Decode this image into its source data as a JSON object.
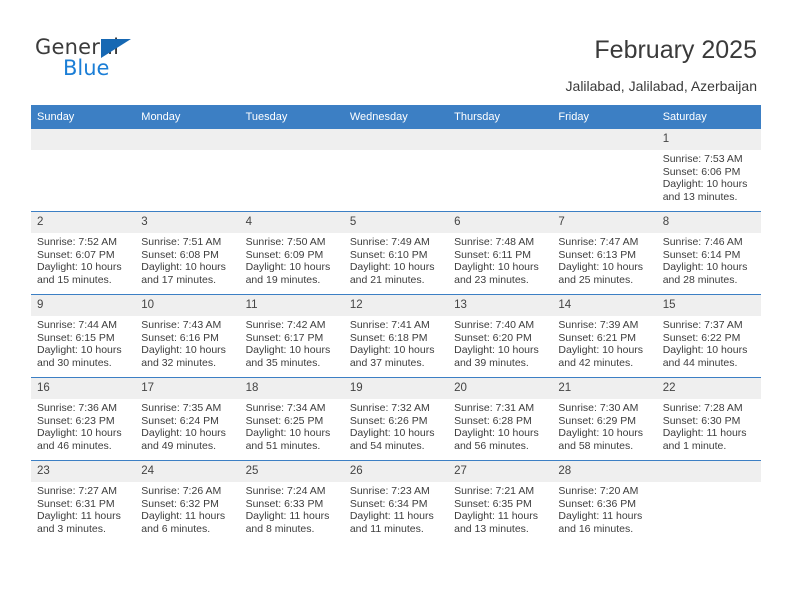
{
  "brand": {
    "name_top": "General",
    "name_bottom": "Blue",
    "accent_color": "#1b7ed6",
    "triangle_color": "#1668b3"
  },
  "header": {
    "title": "February 2025",
    "subtitle": "Jalilabad, Jalilabad, Azerbaijan"
  },
  "calendar": {
    "header_bg": "#3c7fc4",
    "daynum_bg": "#efefef",
    "weekdays": [
      "Sunday",
      "Monday",
      "Tuesday",
      "Wednesday",
      "Thursday",
      "Friday",
      "Saturday"
    ],
    "labels": {
      "sunrise": "Sunrise:",
      "sunset": "Sunset:",
      "daylight": "Daylight:"
    },
    "weeks": [
      [
        {
          "day": "",
          "empty": true
        },
        {
          "day": "",
          "empty": true
        },
        {
          "day": "",
          "empty": true
        },
        {
          "day": "",
          "empty": true
        },
        {
          "day": "",
          "empty": true
        },
        {
          "day": "",
          "empty": true
        },
        {
          "day": "1",
          "sunrise": "Sunrise: 7:53 AM",
          "sunset": "Sunset: 6:06 PM",
          "daylight_line1": "Daylight: 10 hours",
          "daylight_line2": "and 13 minutes."
        }
      ],
      [
        {
          "day": "2",
          "sunrise": "Sunrise: 7:52 AM",
          "sunset": "Sunset: 6:07 PM",
          "daylight_line1": "Daylight: 10 hours",
          "daylight_line2": "and 15 minutes."
        },
        {
          "day": "3",
          "sunrise": "Sunrise: 7:51 AM",
          "sunset": "Sunset: 6:08 PM",
          "daylight_line1": "Daylight: 10 hours",
          "daylight_line2": "and 17 minutes."
        },
        {
          "day": "4",
          "sunrise": "Sunrise: 7:50 AM",
          "sunset": "Sunset: 6:09 PM",
          "daylight_line1": "Daylight: 10 hours",
          "daylight_line2": "and 19 minutes."
        },
        {
          "day": "5",
          "sunrise": "Sunrise: 7:49 AM",
          "sunset": "Sunset: 6:10 PM",
          "daylight_line1": "Daylight: 10 hours",
          "daylight_line2": "and 21 minutes."
        },
        {
          "day": "6",
          "sunrise": "Sunrise: 7:48 AM",
          "sunset": "Sunset: 6:11 PM",
          "daylight_line1": "Daylight: 10 hours",
          "daylight_line2": "and 23 minutes."
        },
        {
          "day": "7",
          "sunrise": "Sunrise: 7:47 AM",
          "sunset": "Sunset: 6:13 PM",
          "daylight_line1": "Daylight: 10 hours",
          "daylight_line2": "and 25 minutes."
        },
        {
          "day": "8",
          "sunrise": "Sunrise: 7:46 AM",
          "sunset": "Sunset: 6:14 PM",
          "daylight_line1": "Daylight: 10 hours",
          "daylight_line2": "and 28 minutes."
        }
      ],
      [
        {
          "day": "9",
          "sunrise": "Sunrise: 7:44 AM",
          "sunset": "Sunset: 6:15 PM",
          "daylight_line1": "Daylight: 10 hours",
          "daylight_line2": "and 30 minutes."
        },
        {
          "day": "10",
          "sunrise": "Sunrise: 7:43 AM",
          "sunset": "Sunset: 6:16 PM",
          "daylight_line1": "Daylight: 10 hours",
          "daylight_line2": "and 32 minutes."
        },
        {
          "day": "11",
          "sunrise": "Sunrise: 7:42 AM",
          "sunset": "Sunset: 6:17 PM",
          "daylight_line1": "Daylight: 10 hours",
          "daylight_line2": "and 35 minutes."
        },
        {
          "day": "12",
          "sunrise": "Sunrise: 7:41 AM",
          "sunset": "Sunset: 6:18 PM",
          "daylight_line1": "Daylight: 10 hours",
          "daylight_line2": "and 37 minutes."
        },
        {
          "day": "13",
          "sunrise": "Sunrise: 7:40 AM",
          "sunset": "Sunset: 6:20 PM",
          "daylight_line1": "Daylight: 10 hours",
          "daylight_line2": "and 39 minutes."
        },
        {
          "day": "14",
          "sunrise": "Sunrise: 7:39 AM",
          "sunset": "Sunset: 6:21 PM",
          "daylight_line1": "Daylight: 10 hours",
          "daylight_line2": "and 42 minutes."
        },
        {
          "day": "15",
          "sunrise": "Sunrise: 7:37 AM",
          "sunset": "Sunset: 6:22 PM",
          "daylight_line1": "Daylight: 10 hours",
          "daylight_line2": "and 44 minutes."
        }
      ],
      [
        {
          "day": "16",
          "sunrise": "Sunrise: 7:36 AM",
          "sunset": "Sunset: 6:23 PM",
          "daylight_line1": "Daylight: 10 hours",
          "daylight_line2": "and 46 minutes."
        },
        {
          "day": "17",
          "sunrise": "Sunrise: 7:35 AM",
          "sunset": "Sunset: 6:24 PM",
          "daylight_line1": "Daylight: 10 hours",
          "daylight_line2": "and 49 minutes."
        },
        {
          "day": "18",
          "sunrise": "Sunrise: 7:34 AM",
          "sunset": "Sunset: 6:25 PM",
          "daylight_line1": "Daylight: 10 hours",
          "daylight_line2": "and 51 minutes."
        },
        {
          "day": "19",
          "sunrise": "Sunrise: 7:32 AM",
          "sunset": "Sunset: 6:26 PM",
          "daylight_line1": "Daylight: 10 hours",
          "daylight_line2": "and 54 minutes."
        },
        {
          "day": "20",
          "sunrise": "Sunrise: 7:31 AM",
          "sunset": "Sunset: 6:28 PM",
          "daylight_line1": "Daylight: 10 hours",
          "daylight_line2": "and 56 minutes."
        },
        {
          "day": "21",
          "sunrise": "Sunrise: 7:30 AM",
          "sunset": "Sunset: 6:29 PM",
          "daylight_line1": "Daylight: 10 hours",
          "daylight_line2": "and 58 minutes."
        },
        {
          "day": "22",
          "sunrise": "Sunrise: 7:28 AM",
          "sunset": "Sunset: 6:30 PM",
          "daylight_line1": "Daylight: 11 hours",
          "daylight_line2": "and 1 minute."
        }
      ],
      [
        {
          "day": "23",
          "sunrise": "Sunrise: 7:27 AM",
          "sunset": "Sunset: 6:31 PM",
          "daylight_line1": "Daylight: 11 hours",
          "daylight_line2": "and 3 minutes."
        },
        {
          "day": "24",
          "sunrise": "Sunrise: 7:26 AM",
          "sunset": "Sunset: 6:32 PM",
          "daylight_line1": "Daylight: 11 hours",
          "daylight_line2": "and 6 minutes."
        },
        {
          "day": "25",
          "sunrise": "Sunrise: 7:24 AM",
          "sunset": "Sunset: 6:33 PM",
          "daylight_line1": "Daylight: 11 hours",
          "daylight_line2": "and 8 minutes."
        },
        {
          "day": "26",
          "sunrise": "Sunrise: 7:23 AM",
          "sunset": "Sunset: 6:34 PM",
          "daylight_line1": "Daylight: 11 hours",
          "daylight_line2": "and 11 minutes."
        },
        {
          "day": "27",
          "sunrise": "Sunrise: 7:21 AM",
          "sunset": "Sunset: 6:35 PM",
          "daylight_line1": "Daylight: 11 hours",
          "daylight_line2": "and 13 minutes."
        },
        {
          "day": "28",
          "sunrise": "Sunrise: 7:20 AM",
          "sunset": "Sunset: 6:36 PM",
          "daylight_line1": "Daylight: 11 hours",
          "daylight_line2": "and 16 minutes."
        },
        {
          "day": "",
          "empty": true
        }
      ]
    ]
  }
}
